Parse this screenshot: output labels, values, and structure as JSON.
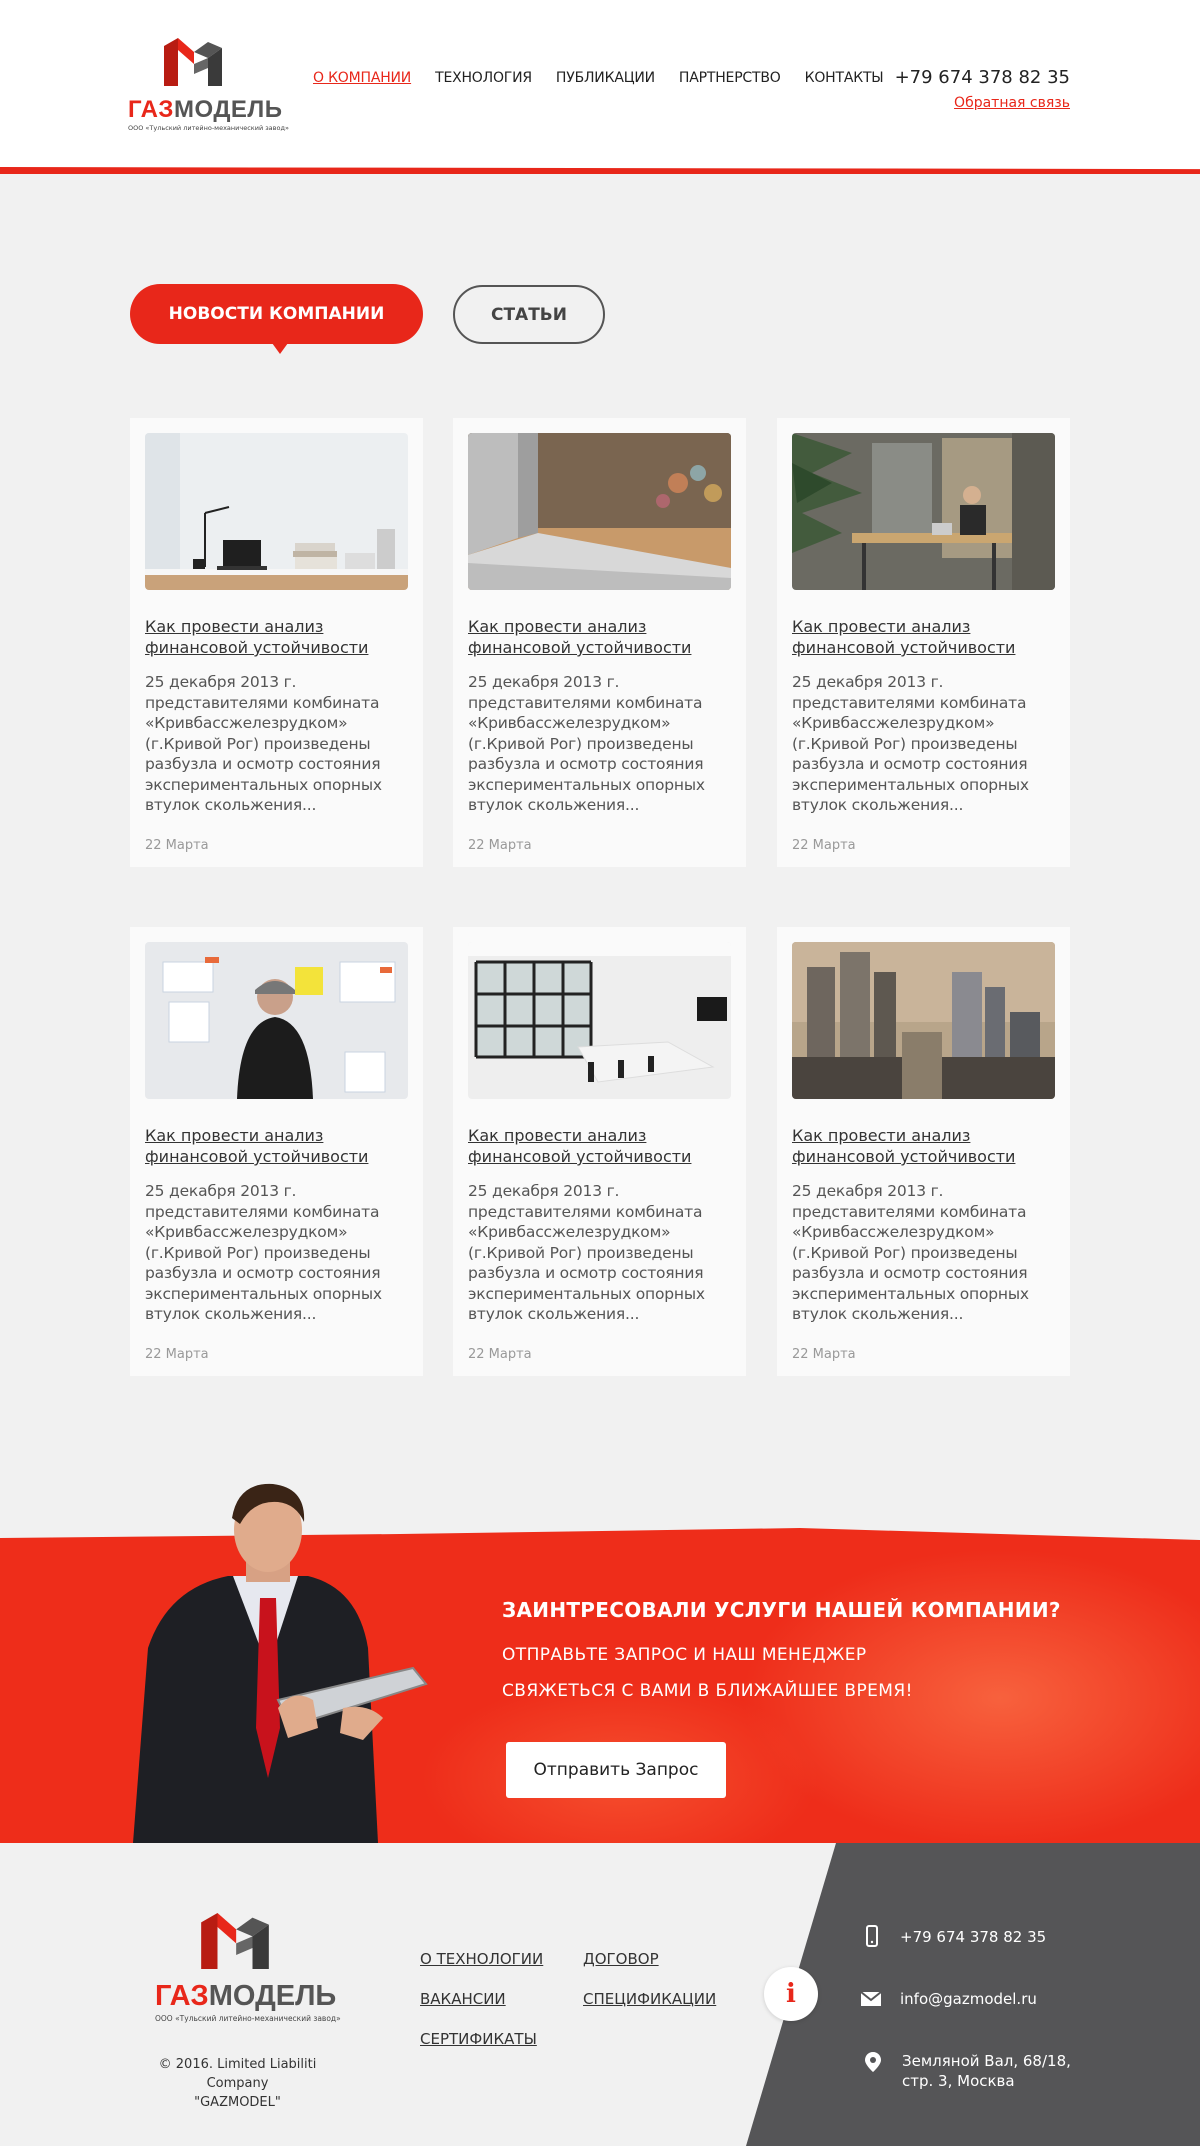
{
  "header": {
    "logo": {
      "name_red": "ГАЗ",
      "name_grey": "МОДЕЛЬ",
      "subtitle": "ООО «Тульский литейно-механический завод»"
    },
    "nav": [
      {
        "label": "О компании",
        "active": true
      },
      {
        "label": "Технология",
        "active": false
      },
      {
        "label": "Публикации",
        "active": false
      },
      {
        "label": "Партнерство",
        "active": false
      },
      {
        "label": "Контакты",
        "active": false
      }
    ],
    "phone": "+79 674 378 82 35",
    "feedback_link": "Обратная связь"
  },
  "tabs": {
    "news": "Новости компании",
    "articles": "Статьи"
  },
  "cards": [
    {
      "image": "desk-workspace-photo",
      "title": "Как провести анализ финансовой устойчивости",
      "text": "25 декабря 2013 г. представителями комбината «Кривбассжелезрудком» (г.Кривой Рог) произведены разбузла и осмотр состояния экспериментальных опорных втулок скольжения...",
      "date": "22 Марта"
    },
    {
      "image": "laptop-photo",
      "title": "Как провести анализ финансовой устойчивости",
      "text": "25 декабря 2013 г. представителями комбината «Кривбассжелезрудком» (г.Кривой Рог) произведены разбузла и осмотр состояния экспериментальных опорных втулок скольжения...",
      "date": "22 Марта"
    },
    {
      "image": "office-man-laptop-photo",
      "title": "Как провести анализ финансовой устойчивости",
      "text": "25 декабря 2013 г. представителями комбината «Кривбассжелезрудком» (г.Кривой Рог) произведены разбузла и осмотр состояния экспериментальных опорных втулок скольжения...",
      "date": "22 Марта"
    },
    {
      "image": "man-whiteboard-photo",
      "title": "Как провести анализ финансовой устойчивости",
      "text": "25 декабря 2013 г. представителями комбината «Кривбассжелезрудком» (г.Кривой Рог) произведены разбузла и осмотр состояния экспериментальных опорных втулок скольжения...",
      "date": "22 Марта"
    },
    {
      "image": "meeting-room-photo",
      "title": "Как провести анализ финансовой устойчивости",
      "text": "25 декабря 2013 г. представителями комбината «Кривбассжелезрудком» (г.Кривой Рог) произведены разбузла и осмотр состояния экспериментальных опорных втулок скольжения...",
      "date": "22 Марта"
    },
    {
      "image": "city-skyline-photo",
      "title": "Как провести анализ финансовой устойчивости",
      "text": "25 декабря 2013 г. представителями комбината «Кривбассжелезрудком» (г.Кривой Рог) произведены разбузла и осмотр состояния экспериментальных опорных втулок скольжения...",
      "date": "22 Марта"
    }
  ],
  "cta": {
    "title": "Заинтресовали услуги нашей компании?",
    "line1": "Отправьте запрос и наш менеджер",
    "line2": "свяжеться с вами в ближайшее время!",
    "button": "Отправить Запрос"
  },
  "footer": {
    "logo": {
      "name_red": "ГАЗ",
      "name_grey": "МОДЕЛЬ",
      "subtitle": "ООО «Тульский литейно-механический завод»"
    },
    "copyright_line1": "© 2016. Limited Liabiliti Company",
    "copyright_line2": "\"GAZMODEL\"",
    "links": [
      "О технологии",
      "Договор",
      "Вакансии",
      "Спецификации",
      "Сертификаты"
    ],
    "info_icon": "i",
    "phone": "+79 674 378 82 35",
    "email": "info@gazmodel.ru",
    "address_line1": "Земляной Вал, 68/18,",
    "address_line2": "стр. 3, Москва"
  },
  "colors": {
    "accent": "#e8271a",
    "dark": "#555557",
    "background": "#f1f1f1"
  }
}
